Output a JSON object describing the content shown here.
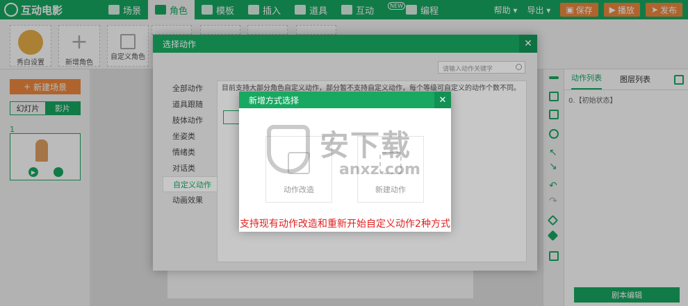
{
  "app": {
    "name": "互动电影"
  },
  "nav": [
    {
      "label": "场景",
      "icon": "grid-icon",
      "active": false
    },
    {
      "label": "角色",
      "icon": "person-icon",
      "active": true
    },
    {
      "label": "模板",
      "icon": "puzzle-icon",
      "active": false
    },
    {
      "label": "插入",
      "icon": "image-icon",
      "active": false
    },
    {
      "label": "道具",
      "icon": "palette-icon",
      "active": false
    },
    {
      "label": "互动",
      "icon": "diamond-icon",
      "active": false
    },
    {
      "label": "编程",
      "icon": "code-icon",
      "active": false,
      "badge": "NEW"
    }
  ],
  "top_right": {
    "help": "帮助",
    "export": "导出",
    "save": "保存",
    "play": "播放",
    "publish": "发布"
  },
  "char_bar": {
    "avatar_settings": "秀白设置",
    "new_char": "新增角色",
    "custom_char": "自定义角色"
  },
  "left_panel": {
    "new_scene": "新建场景",
    "mode_slides": "幻灯片",
    "mode_film": "影片",
    "scene_number": "1"
  },
  "right_panel": {
    "tab_actions": "动作列表",
    "tab_layers": "图层列表",
    "state_item": "0.【初始状态】",
    "script_edit": "剧本编辑"
  },
  "dialog_actions": {
    "title": "选择动作",
    "search_placeholder": "请输入动作关键字",
    "categories": [
      "全部动作",
      "道具跟随",
      "肢体动作",
      "坐姿类",
      "情绪类",
      "对话类",
      "自定义动作",
      "动画效果"
    ],
    "selected_category": "自定义动作",
    "description": "目前支持大部分角色自定义动作，部分暂不支持自定义动作，每个等级可自定义的动作个数不同。"
  },
  "dialog_method": {
    "title": "新增方式选择",
    "option_modify": "动作改造",
    "option_new": "新建动作",
    "annotation": "支持现有动作改造和重新开始自定义动作2种方式"
  },
  "watermark": {
    "cn": "安下载",
    "en": "anxz.com"
  },
  "colors": {
    "primary": "#19a862",
    "accent": "#f08a3e",
    "annotation": "#e02020"
  }
}
